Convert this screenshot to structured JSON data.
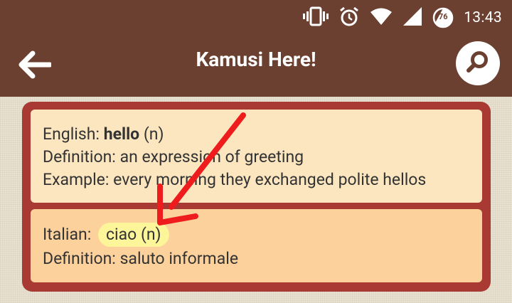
{
  "status_bar": {
    "time": "13:43",
    "battery_level": "76",
    "icons": [
      "vibrate-icon",
      "alarm-icon",
      "wifi-icon",
      "cellular-signal-icon",
      "battery-icon"
    ]
  },
  "app_bar": {
    "title": "Kamusi Here!",
    "back_icon": "arrow-left-icon",
    "search_icon": "search-icon",
    "color": "#6b4031"
  },
  "source_entry": {
    "language_label": "English:",
    "word": "hello",
    "part_of_speech": "(n)",
    "definition_label": "Definition:",
    "definition": "an expression of greeting",
    "example_label": "Example:",
    "example": "every morning they exchanged polite hellos"
  },
  "translation_entry": {
    "language_label": "Italian:",
    "term": "ciao (n)",
    "definition_label": "Definition:",
    "definition": "saluto informale"
  },
  "colors": {
    "panel": "#a93a33",
    "source_card": "#fbe6c0",
    "translation_card": "#fdd19b",
    "highlight": "#fdf59a",
    "annotation_arrow": "#ee1c1c"
  }
}
